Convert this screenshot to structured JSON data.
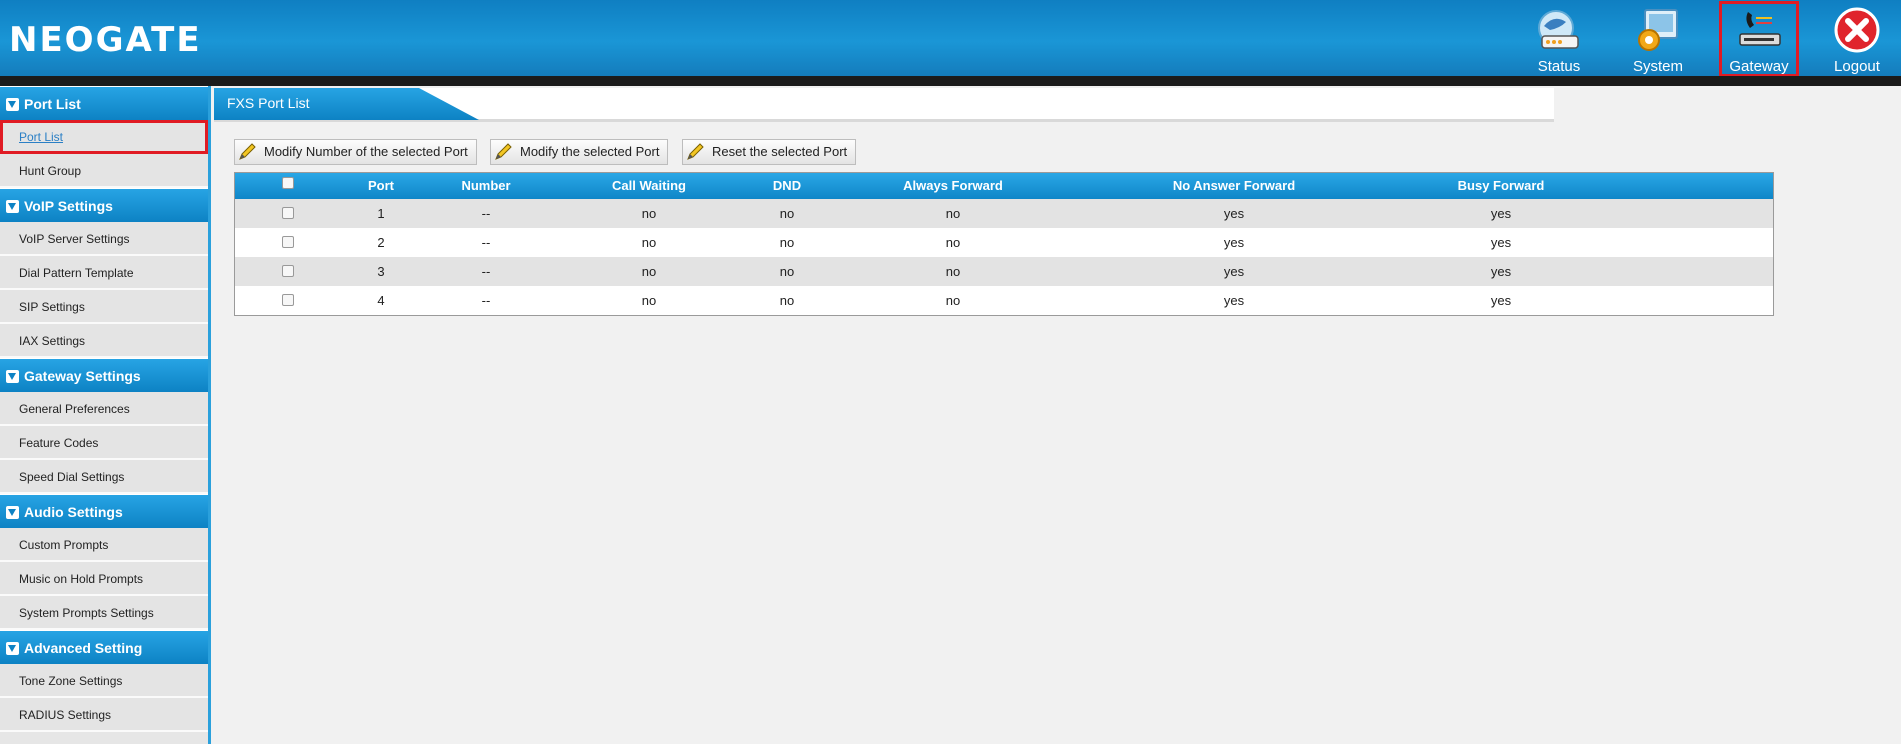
{
  "header": {
    "logo": "NEOGATE",
    "nav": [
      {
        "label": "Status",
        "icon": "status-icon"
      },
      {
        "label": "System",
        "icon": "system-icon"
      },
      {
        "label": "Gateway",
        "icon": "gateway-icon",
        "active": true
      },
      {
        "label": "Logout",
        "icon": "logout-icon"
      }
    ]
  },
  "sidebar": {
    "sections": [
      {
        "title": "Port List",
        "items": [
          "Port List",
          "Hunt Group"
        ]
      },
      {
        "title": "VoIP Settings",
        "items": [
          "VoIP Server Settings",
          "Dial Pattern Template",
          "SIP Settings",
          "IAX Settings"
        ]
      },
      {
        "title": "Gateway Settings",
        "items": [
          "General Preferences",
          "Feature Codes",
          "Speed Dial Settings"
        ]
      },
      {
        "title": "Audio Settings",
        "items": [
          "Custom Prompts",
          "Music on Hold Prompts",
          "System Prompts Settings"
        ]
      },
      {
        "title": "Advanced Setting",
        "items": [
          "Tone Zone Settings",
          "RADIUS Settings"
        ]
      }
    ],
    "selected_item": "Port List"
  },
  "main": {
    "tab_title": "FXS Port List",
    "toolbar": {
      "modify_number_label": "Modify Number of the selected Port",
      "modify_port_label": "Modify the selected Port",
      "reset_port_label": "Reset the selected Port"
    },
    "table": {
      "columns": [
        "Port",
        "Number",
        "Call Waiting",
        "DND",
        "Always Forward",
        "No Answer Forward",
        "Busy Forward"
      ],
      "rows": [
        {
          "port": "1",
          "number": "--",
          "call_waiting": "no",
          "dnd": "no",
          "always_forward": "no",
          "no_answer_forward": "yes",
          "busy_forward": "yes"
        },
        {
          "port": "2",
          "number": "--",
          "call_waiting": "no",
          "dnd": "no",
          "always_forward": "no",
          "no_answer_forward": "yes",
          "busy_forward": "yes"
        },
        {
          "port": "3",
          "number": "--",
          "call_waiting": "no",
          "dnd": "no",
          "always_forward": "no",
          "no_answer_forward": "yes",
          "busy_forward": "yes"
        },
        {
          "port": "4",
          "number": "--",
          "call_waiting": "no",
          "dnd": "no",
          "always_forward": "no",
          "no_answer_forward": "yes",
          "busy_forward": "yes"
        }
      ]
    }
  },
  "colors": {
    "header_blue": "#1a96d6",
    "highlight_red": "#e01b24",
    "link_blue": "#2a7fc5"
  }
}
